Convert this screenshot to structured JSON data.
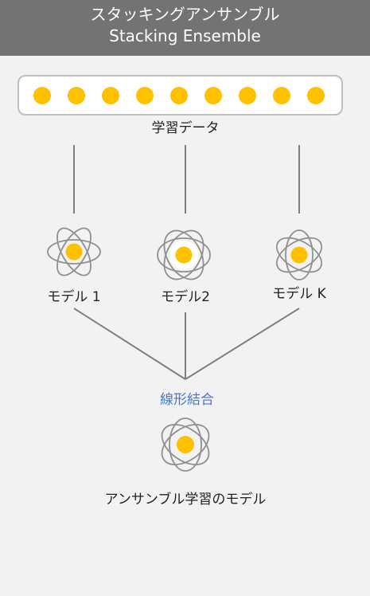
{
  "header": {
    "title_ja": "スタッキングアンサンブル",
    "title_en": "Stacking Ensemble",
    "background": "#737373"
  },
  "data_box": {
    "dot_count": 9,
    "label": "学習データ",
    "dot_color": "#ffc000"
  },
  "models": [
    {
      "label": "モデル 1",
      "icon": "atom-icon"
    },
    {
      "label": "モデル2",
      "icon": "atom-icon"
    },
    {
      "label": "モデル K",
      "icon": "atom-icon"
    }
  ],
  "combine": {
    "label": "線形結合",
    "label_color": "#4a78c4"
  },
  "final_model": {
    "label": "アンサンブル学習のモデル",
    "icon": "atom-icon"
  },
  "colors": {
    "nucleus": "#ffc000",
    "orbit": "#909090",
    "line": "#7f7f7f",
    "panel_bg": "#f2f2f2"
  }
}
